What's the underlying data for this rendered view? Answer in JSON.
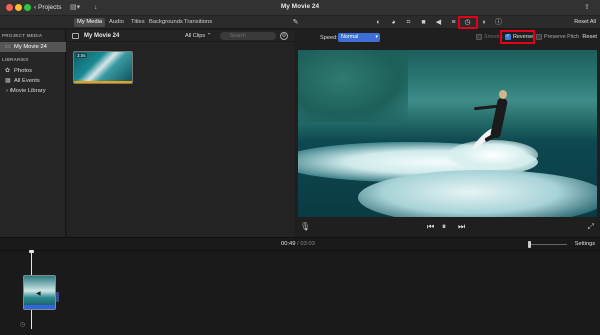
{
  "window": {
    "title": "My Movie 24",
    "back_label": "Projects"
  },
  "media_tabs": [
    "My Media",
    "Audio",
    "Titles",
    "Backgrounds",
    "Transitions"
  ],
  "adjust_toolbar": {
    "icons": [
      "magic-wand",
      "color-balance",
      "color-correction",
      "crop",
      "stabilization",
      "volume",
      "noise-reduction",
      "speed",
      "clip-filter",
      "info"
    ],
    "highlighted": "speed",
    "reset_all_label": "Reset All"
  },
  "sidebar": {
    "project_media_header": "PROJECT MEDIA",
    "project_item": "My Movie 24",
    "libraries_header": "LIBRARIES",
    "library_items": [
      "Photos",
      "All Events",
      "iMovie Library"
    ]
  },
  "browser": {
    "title": "My Movie 24",
    "filter_label": "All Clips",
    "search_placeholder": "Search",
    "clip": {
      "duration": "3.0s"
    }
  },
  "speed_panel": {
    "speed_label": "Speed:",
    "speed_value": "Normal",
    "smooth_label": "Smooth",
    "reverse_label": "Reverse",
    "reverse_checked": true,
    "preserve_pitch_label": "Preserve Pitch",
    "reset_label": "Reset"
  },
  "timeline": {
    "current_time": "00:49",
    "separator": "/",
    "total_time": "03:03",
    "settings_label": "Settings"
  },
  "colors": {
    "highlight_border": "#e3001b",
    "accent_blue": "#3d6fd6",
    "clip_bar": "#e9a400"
  }
}
